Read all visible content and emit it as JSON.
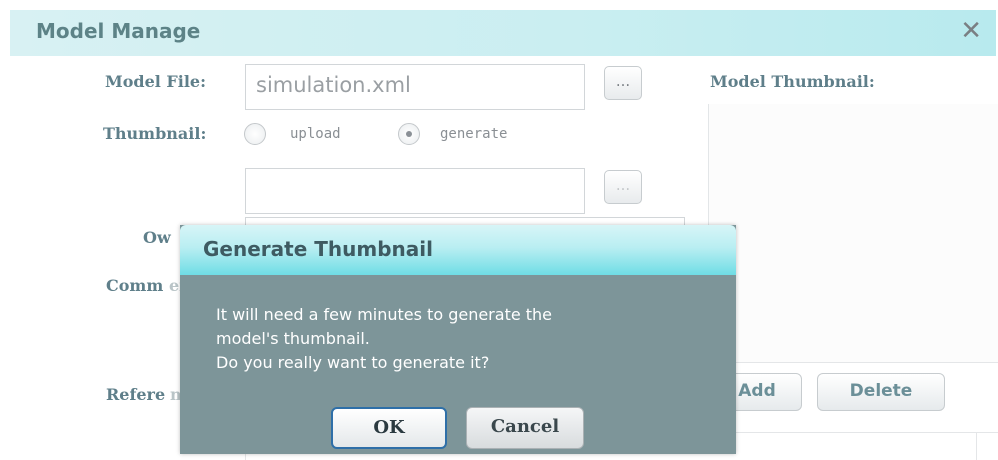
{
  "window": {
    "title": "Model Manage",
    "close_symbol": "✕",
    "model_file_label": "Model File:",
    "model_file_value": "simulation.xml",
    "browse_label": "...",
    "thumbnail_label": "Thumbnail:",
    "upload_label": "upload",
    "generate_label": "generate",
    "thumbnail_mode": "generate",
    "owner_label": "Ow",
    "comments_label": "Comm",
    "comments_suffix": "ents:",
    "reference_label": "Refere",
    "reference_suffix": "nce:",
    "model_thumbnail_label": "Model Thumbnail:",
    "add_label": "Add",
    "delete_label": "Delete"
  },
  "dialog": {
    "title": "Generate Thumbnail",
    "message_lines": [
      "It will need a few minutes to generate the",
      "model's thumbnail.",
      "Do you really want to generate it?"
    ],
    "ok_label": "OK",
    "cancel_label": "Cancel"
  },
  "colors": {
    "title_bar": "#c9eef1",
    "dialog_body": "#7d9599",
    "label_text": "#5f7f8a",
    "ok_border": "#2e6fa8"
  },
  "icons": {
    "close": "close-icon",
    "browse": "ellipsis-icon"
  }
}
